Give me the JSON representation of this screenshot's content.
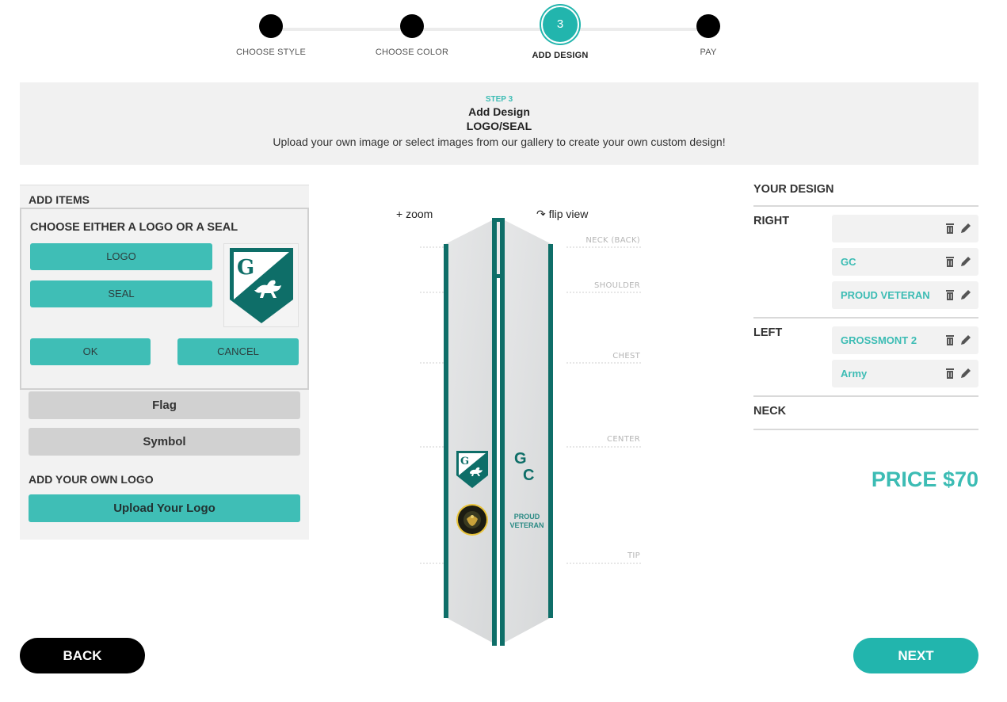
{
  "stepper": {
    "steps": [
      {
        "label": "CHOOSE STYLE",
        "number": ""
      },
      {
        "label": "CHOOSE COLOR",
        "number": ""
      },
      {
        "label": "ADD DESIGN",
        "number": "3"
      },
      {
        "label": "PAY",
        "number": ""
      }
    ],
    "active_step": 3
  },
  "banner": {
    "kicker": "STEP 3",
    "title_line1": "Add Design",
    "title_line2": "LOGO/SEAL",
    "subtitle": "Upload your own image or select images from our gallery to create your own custom design!"
  },
  "add_items": {
    "header": "ADD ITEMS",
    "chooser": {
      "question": "CHOOSE EITHER A LOGO OR A SEAL",
      "logo_label": "LOGO",
      "seal_label": "SEAL",
      "ok_label": "OK",
      "cancel_label": "CANCEL",
      "preview_icon": "grossmont-shield-logo"
    },
    "flag_label": "Flag",
    "symbol_label": "Symbol",
    "own_logo_header": "ADD YOUR OWN LOGO",
    "upload_label": "Upload Your Logo"
  },
  "preview": {
    "zoom_label": "+ zoom",
    "flip_label": "flip view",
    "markers": [
      "NECK (BACK)",
      "SHOULDER",
      "CHEST",
      "CENTER",
      "TIP"
    ],
    "right_panel_text": {
      "line1": "G",
      "line2": "C",
      "veteran1": "PROUD",
      "veteran2": "VETERAN"
    },
    "left_panel_icons": [
      "grossmont-shield-logo",
      "army-seal"
    ]
  },
  "your_design": {
    "title": "YOUR DESIGN",
    "sections": [
      {
        "label": "RIGHT",
        "items": [
          "",
          "GC",
          "PROUD VETERAN"
        ]
      },
      {
        "label": "LEFT",
        "items": [
          "GROSSMONT 2",
          "Army"
        ]
      },
      {
        "label": "NECK",
        "items": []
      }
    ]
  },
  "price": "PRICE $70",
  "nav": {
    "back_label": "BACK",
    "next_label": "NEXT"
  },
  "colors": {
    "accent": "#22b5ad",
    "button_teal": "#3fbeb6",
    "stole_trim": "#0e6e68",
    "stole_body": "#dcdedf"
  }
}
